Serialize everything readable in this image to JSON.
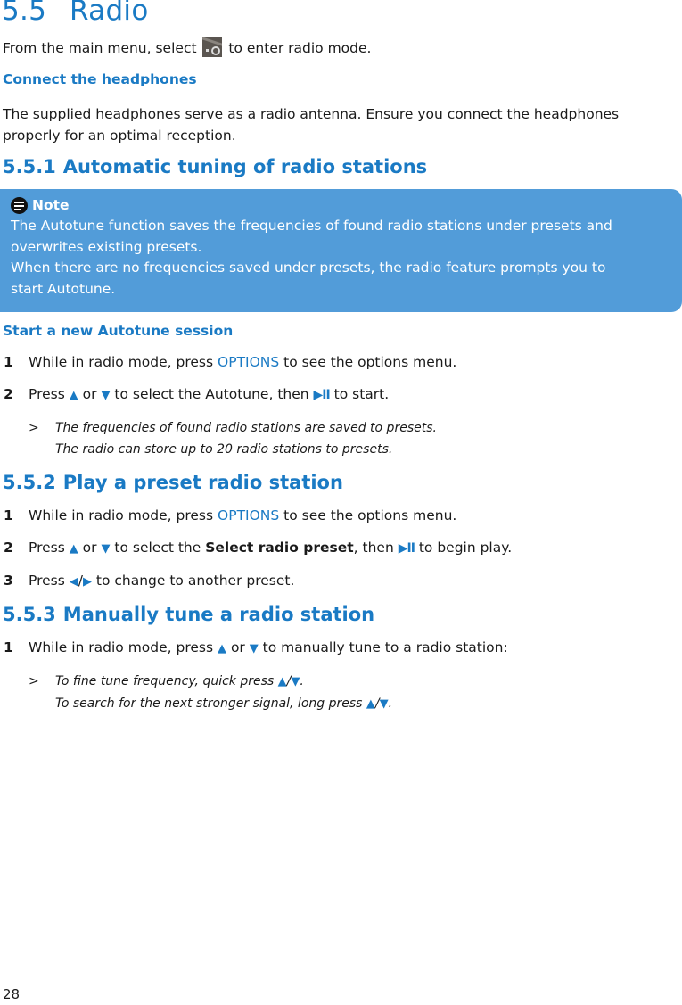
{
  "section": {
    "number": "5.5",
    "title": "Radio",
    "intro_before": "From the main menu, select ",
    "intro_icon": "radio-icon",
    "intro_after": " to enter radio mode."
  },
  "headphones": {
    "heading": "Connect the headphones",
    "line1": "The supplied headphones serve as a radio antenna. Ensure you connect the headphones",
    "line2": "properly for an optimal reception."
  },
  "autotune_section": {
    "number": "5.5.1",
    "title": "Automatic tuning of radio stations",
    "note": {
      "icon": "note-icon",
      "label": "Note",
      "lines": [
        "The Autotune function saves the frequencies of found radio stations under presets and",
        "overwrites existing presets.",
        "When there are no frequencies saved under presets, the radio feature prompts you to",
        "start Autotune."
      ]
    },
    "subheading": "Start a new Autotune session",
    "steps": [
      {
        "n": "1",
        "a": "While in radio mode, press ",
        "key": "OPTIONS",
        "b": " to see the options menu."
      },
      {
        "n": "2",
        "a": "Press ",
        "up": "▲",
        "or": " or ",
        "down": "▼",
        "b": " to select the Autotune, then ",
        "play": "▶II",
        "c": " to start."
      }
    ],
    "result": {
      "marker": ">",
      "line1": "The frequencies of found radio stations are saved to presets.",
      "line2": "The radio can store up to 20 radio stations to presets."
    }
  },
  "preset_section": {
    "number": "5.5.2",
    "title": "Play a preset radio station",
    "steps": [
      {
        "n": "1",
        "a": "While in radio mode, press ",
        "key": "OPTIONS",
        "b": " to see the options menu."
      },
      {
        "n": "2",
        "a": "Press ",
        "up": "▲",
        "or": " or ",
        "down": "▼",
        "b": " to select the ",
        "bold": "Select radio preset",
        "c": ", then ",
        "play": "▶II",
        "d": " to begin play."
      },
      {
        "n": "3",
        "a": "Press ",
        "left": "◀",
        "slash": "/",
        "right": "▶",
        "b": " to change to another preset."
      }
    ]
  },
  "manual_section": {
    "number": "5.5.3",
    "title": "Manually tune a radio station",
    "steps": [
      {
        "n": "1",
        "a": "While in radio mode, press ",
        "up": "▲",
        "or": " or ",
        "down": "▼",
        "b": " to manually tune to a radio station:"
      }
    ],
    "result": {
      "marker": ">",
      "line1_a": "To fine tune frequency, quick press ",
      "line2_a": "To search for the next stronger signal, long press ",
      "up": "▲",
      "slash": "/",
      "down": "▼",
      "end": "."
    }
  },
  "footer": {
    "page_number": "28"
  }
}
